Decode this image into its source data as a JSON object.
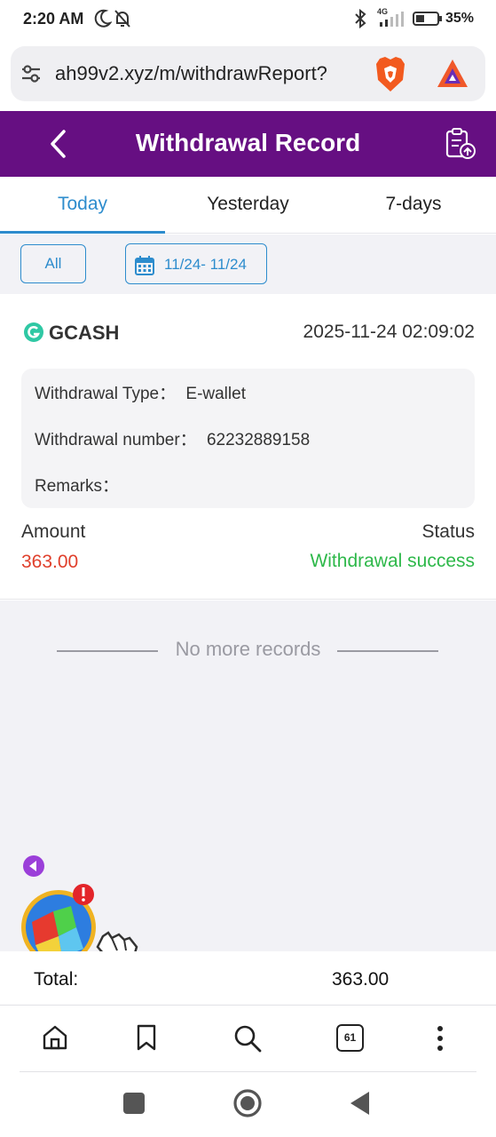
{
  "status_bar": {
    "time": "2:20 AM",
    "network": "4G",
    "battery": "35%"
  },
  "browser": {
    "url": "ah99v2.xyz/m/withdrawReport?",
    "tab_count": "61"
  },
  "header": {
    "title": "Withdrawal Record"
  },
  "tabs": [
    {
      "label": "Today",
      "active": true
    },
    {
      "label": "Yesterday",
      "active": false
    },
    {
      "label": "7-days",
      "active": false
    }
  ],
  "filters": {
    "all_label": "All",
    "date_range": "11/24- 11/24"
  },
  "record": {
    "method": "GCASH",
    "datetime": "2025-11-24 02:09:02",
    "type_label": "Withdrawal Type：",
    "type_value": "E-wallet",
    "number_label": "Withdrawal number：",
    "number_value": "62232889158",
    "remarks_label": "Remarks：",
    "remarks_value": "",
    "amount_label": "Amount",
    "amount_value": "363.00",
    "status_label": "Status",
    "status_value": "Withdrawal success"
  },
  "list_footer": "No more records",
  "badge": "!",
  "total": {
    "label": "Total:",
    "value": "363.00"
  },
  "colors": {
    "header_bg": "#660f82",
    "accent": "#2d8ccd",
    "amount": "#e0402c",
    "success": "#2eb84a"
  },
  "icons": {
    "back": "chevron-left-icon",
    "report": "clipboard-upload-icon",
    "calendar": "calendar-icon",
    "gcash": "gcash-logo-icon"
  }
}
